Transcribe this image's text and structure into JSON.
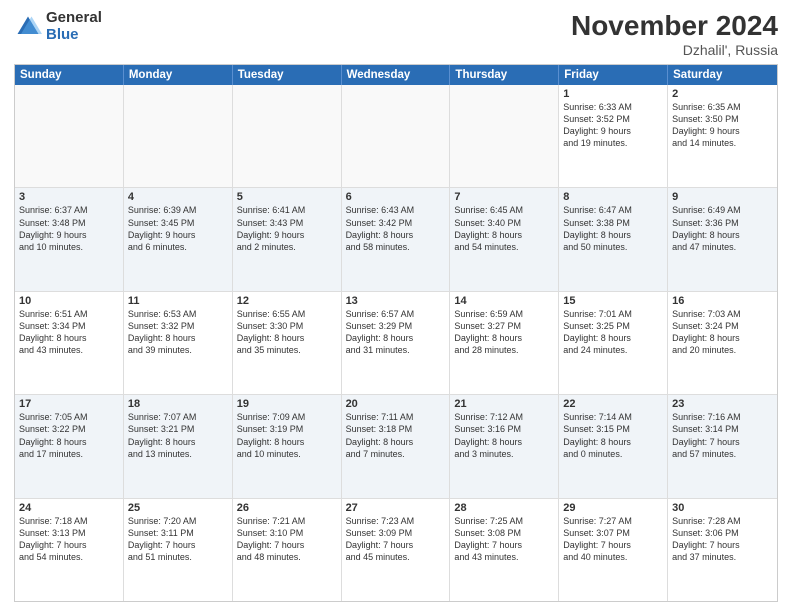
{
  "logo": {
    "general": "General",
    "blue": "Blue"
  },
  "title": {
    "month": "November 2024",
    "location": "Dzhalil', Russia"
  },
  "calendar": {
    "days_of_week": [
      "Sunday",
      "Monday",
      "Tuesday",
      "Wednesday",
      "Thursday",
      "Friday",
      "Saturday"
    ],
    "rows": [
      [
        {
          "day": "",
          "info": "",
          "empty": true
        },
        {
          "day": "",
          "info": "",
          "empty": true
        },
        {
          "day": "",
          "info": "",
          "empty": true
        },
        {
          "day": "",
          "info": "",
          "empty": true
        },
        {
          "day": "",
          "info": "",
          "empty": true
        },
        {
          "day": "1",
          "info": "Sunrise: 6:33 AM\nSunset: 3:52 PM\nDaylight: 9 hours\nand 19 minutes.",
          "empty": false
        },
        {
          "day": "2",
          "info": "Sunrise: 6:35 AM\nSunset: 3:50 PM\nDaylight: 9 hours\nand 14 minutes.",
          "empty": false
        }
      ],
      [
        {
          "day": "3",
          "info": "Sunrise: 6:37 AM\nSunset: 3:48 PM\nDaylight: 9 hours\nand 10 minutes.",
          "empty": false
        },
        {
          "day": "4",
          "info": "Sunrise: 6:39 AM\nSunset: 3:45 PM\nDaylight: 9 hours\nand 6 minutes.",
          "empty": false
        },
        {
          "day": "5",
          "info": "Sunrise: 6:41 AM\nSunset: 3:43 PM\nDaylight: 9 hours\nand 2 minutes.",
          "empty": false
        },
        {
          "day": "6",
          "info": "Sunrise: 6:43 AM\nSunset: 3:42 PM\nDaylight: 8 hours\nand 58 minutes.",
          "empty": false
        },
        {
          "day": "7",
          "info": "Sunrise: 6:45 AM\nSunset: 3:40 PM\nDaylight: 8 hours\nand 54 minutes.",
          "empty": false
        },
        {
          "day": "8",
          "info": "Sunrise: 6:47 AM\nSunset: 3:38 PM\nDaylight: 8 hours\nand 50 minutes.",
          "empty": false
        },
        {
          "day": "9",
          "info": "Sunrise: 6:49 AM\nSunset: 3:36 PM\nDaylight: 8 hours\nand 47 minutes.",
          "empty": false
        }
      ],
      [
        {
          "day": "10",
          "info": "Sunrise: 6:51 AM\nSunset: 3:34 PM\nDaylight: 8 hours\nand 43 minutes.",
          "empty": false
        },
        {
          "day": "11",
          "info": "Sunrise: 6:53 AM\nSunset: 3:32 PM\nDaylight: 8 hours\nand 39 minutes.",
          "empty": false
        },
        {
          "day": "12",
          "info": "Sunrise: 6:55 AM\nSunset: 3:30 PM\nDaylight: 8 hours\nand 35 minutes.",
          "empty": false
        },
        {
          "day": "13",
          "info": "Sunrise: 6:57 AM\nSunset: 3:29 PM\nDaylight: 8 hours\nand 31 minutes.",
          "empty": false
        },
        {
          "day": "14",
          "info": "Sunrise: 6:59 AM\nSunset: 3:27 PM\nDaylight: 8 hours\nand 28 minutes.",
          "empty": false
        },
        {
          "day": "15",
          "info": "Sunrise: 7:01 AM\nSunset: 3:25 PM\nDaylight: 8 hours\nand 24 minutes.",
          "empty": false
        },
        {
          "day": "16",
          "info": "Sunrise: 7:03 AM\nSunset: 3:24 PM\nDaylight: 8 hours\nand 20 minutes.",
          "empty": false
        }
      ],
      [
        {
          "day": "17",
          "info": "Sunrise: 7:05 AM\nSunset: 3:22 PM\nDaylight: 8 hours\nand 17 minutes.",
          "empty": false
        },
        {
          "day": "18",
          "info": "Sunrise: 7:07 AM\nSunset: 3:21 PM\nDaylight: 8 hours\nand 13 minutes.",
          "empty": false
        },
        {
          "day": "19",
          "info": "Sunrise: 7:09 AM\nSunset: 3:19 PM\nDaylight: 8 hours\nand 10 minutes.",
          "empty": false
        },
        {
          "day": "20",
          "info": "Sunrise: 7:11 AM\nSunset: 3:18 PM\nDaylight: 8 hours\nand 7 minutes.",
          "empty": false
        },
        {
          "day": "21",
          "info": "Sunrise: 7:12 AM\nSunset: 3:16 PM\nDaylight: 8 hours\nand 3 minutes.",
          "empty": false
        },
        {
          "day": "22",
          "info": "Sunrise: 7:14 AM\nSunset: 3:15 PM\nDaylight: 8 hours\nand 0 minutes.",
          "empty": false
        },
        {
          "day": "23",
          "info": "Sunrise: 7:16 AM\nSunset: 3:14 PM\nDaylight: 7 hours\nand 57 minutes.",
          "empty": false
        }
      ],
      [
        {
          "day": "24",
          "info": "Sunrise: 7:18 AM\nSunset: 3:13 PM\nDaylight: 7 hours\nand 54 minutes.",
          "empty": false
        },
        {
          "day": "25",
          "info": "Sunrise: 7:20 AM\nSunset: 3:11 PM\nDaylight: 7 hours\nand 51 minutes.",
          "empty": false
        },
        {
          "day": "26",
          "info": "Sunrise: 7:21 AM\nSunset: 3:10 PM\nDaylight: 7 hours\nand 48 minutes.",
          "empty": false
        },
        {
          "day": "27",
          "info": "Sunrise: 7:23 AM\nSunset: 3:09 PM\nDaylight: 7 hours\nand 45 minutes.",
          "empty": false
        },
        {
          "day": "28",
          "info": "Sunrise: 7:25 AM\nSunset: 3:08 PM\nDaylight: 7 hours\nand 43 minutes.",
          "empty": false
        },
        {
          "day": "29",
          "info": "Sunrise: 7:27 AM\nSunset: 3:07 PM\nDaylight: 7 hours\nand 40 minutes.",
          "empty": false
        },
        {
          "day": "30",
          "info": "Sunrise: 7:28 AM\nSunset: 3:06 PM\nDaylight: 7 hours\nand 37 minutes.",
          "empty": false
        }
      ]
    ]
  }
}
